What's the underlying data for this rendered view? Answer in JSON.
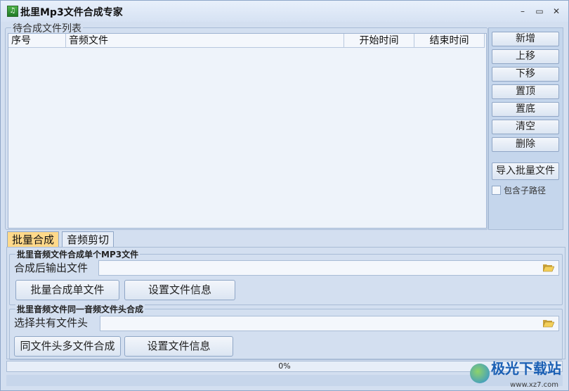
{
  "window": {
    "title": "批里Mp3文件合成专家"
  },
  "controls": {
    "minimize": "–",
    "maximize": "▭",
    "close": "✕"
  },
  "file_list": {
    "legend": "待合成文件列表",
    "columns": [
      "序号",
      "音频文件",
      "开始时间",
      "结束时间"
    ],
    "rows": []
  },
  "side_buttons": {
    "add": "新增",
    "move_up": "上移",
    "move_down": "下移",
    "to_top": "置顶",
    "to_bottom": "置底",
    "clear": "清空",
    "delete": "删除",
    "import_batch": "导入批量文件",
    "include_subpath": "包含子路径"
  },
  "tabs": {
    "batch": "批量合成",
    "audio_cut": "音频剪切"
  },
  "batch_single": {
    "legend": "批里音频文件合成单个MP3文件",
    "output_label": "合成后输出文件",
    "output_value": "",
    "merge_button": "批量合成单文件",
    "info_button": "设置文件信息"
  },
  "batch_same_head": {
    "legend": "批里音频文件同一音频文件头合成",
    "head_label": "选择共有文件头",
    "head_value": "",
    "merge_button": "同文件头多文件合成",
    "info_button": "设置文件信息"
  },
  "progress": {
    "text": "0%",
    "value": 0
  },
  "watermark": {
    "brand": "极光下载站",
    "url": "www.xz7.com"
  },
  "colors": {
    "active_tab": "#ffd98a",
    "window_bg": "#d3dff0"
  }
}
